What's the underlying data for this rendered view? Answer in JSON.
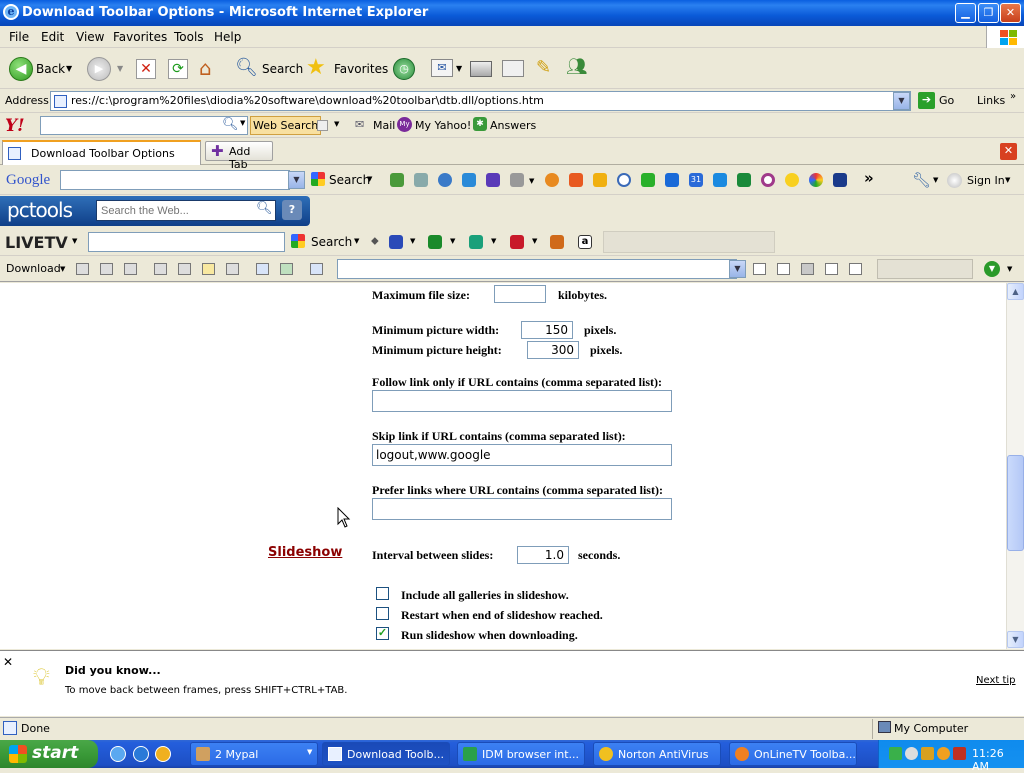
{
  "window": {
    "title": "Download Toolbar Options - Microsoft Internet Explorer"
  },
  "menu": [
    "File",
    "Edit",
    "View",
    "Favorites",
    "Tools",
    "Help"
  ],
  "toolbar": {
    "back": "Back",
    "search": "Search",
    "favorites": "Favorites"
  },
  "address": {
    "label": "Address",
    "url": "res://c:\\program%20files\\diodia%20software\\download%20toolbar\\dtb.dll/options.htm",
    "go": "Go",
    "links": "Links"
  },
  "yahoo": {
    "web_search": "Web Search",
    "mail": "Mail",
    "my_yahoo": "My Yahoo!",
    "answers": "Answers"
  },
  "tabs": {
    "active": "Download Toolbar Options",
    "add": "Add Tab"
  },
  "google": {
    "logo": "Google",
    "search": "Search",
    "sign_in": "Sign In"
  },
  "pctools": {
    "logo": "pctools",
    "placeholder": "Search the Web..."
  },
  "livetv": {
    "logo": "LIVETV",
    "search": "Search"
  },
  "download": {
    "label": "Download"
  },
  "options": {
    "max_file_size_label": "Maximum file size:",
    "max_file_size_value": "",
    "max_file_size_unit": "kilobytes.",
    "min_width_label": "Minimum picture width:",
    "min_width_value": "150",
    "min_width_unit": "pixels.",
    "min_height_label": "Minimum picture height:",
    "min_height_value": "300",
    "min_height_unit": "pixels.",
    "follow_label": "Follow link only if URL contains (comma separated list):",
    "follow_value": "",
    "skip_label": "Skip link if URL contains (comma separated list):",
    "skip_value": "logout,www.google",
    "prefer_label": "Prefer links where URL contains (comma separated list):",
    "prefer_value": "",
    "slideshow_heading": "Slideshow",
    "interval_label": "Interval between slides:",
    "interval_value": "1.0",
    "interval_unit": "seconds.",
    "check_all_galleries": "Include all galleries in slideshow.",
    "check_restart": "Restart when end of slideshow reached.",
    "check_run": "Run slideshow when downloading.",
    "check_all_galleries_checked": false,
    "check_restart_checked": false,
    "check_run_checked": true
  },
  "tip": {
    "title": "Did you know...",
    "text": "To move back between frames, press SHIFT+CTRL+TAB.",
    "next": "Next tip"
  },
  "status": {
    "left": "Done",
    "right": "My Computer"
  },
  "taskbar": {
    "start": "start",
    "tasks": [
      "2 Mypal",
      "Download Toolb...",
      "IDM browser int...",
      "Norton AntiVirus",
      "OnLineTV Toolba..."
    ],
    "clock": "11:26 AM"
  }
}
